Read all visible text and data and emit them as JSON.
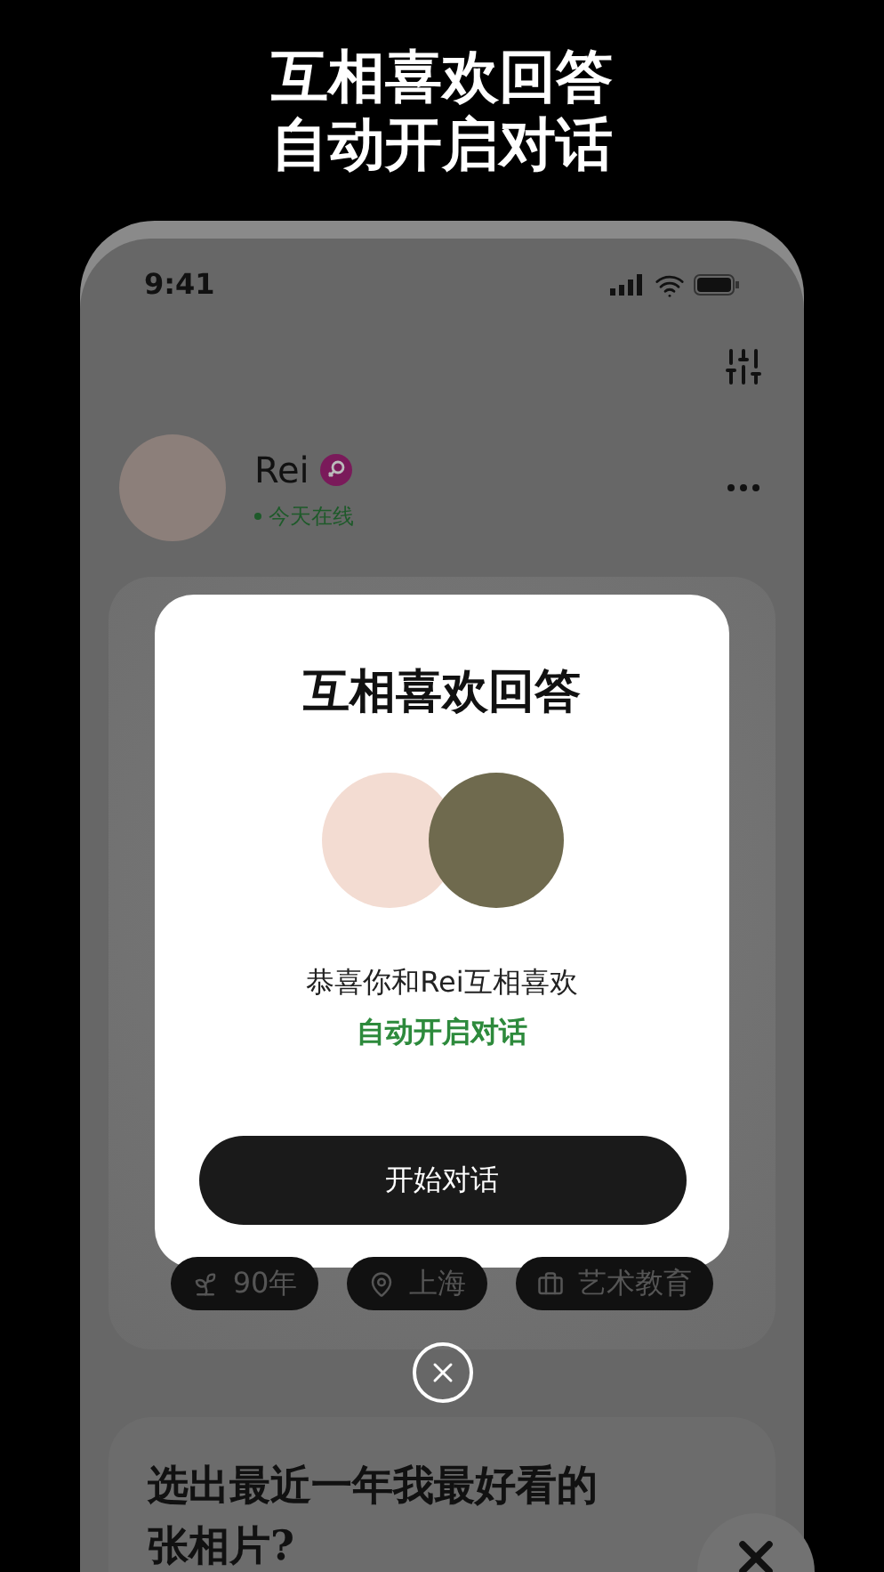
{
  "headline": [
    "互相喜欢回答",
    "自动开启对话"
  ],
  "status_bar": {
    "time": "9:41"
  },
  "profile": {
    "name": "Rei",
    "online": true,
    "status": "今天在线"
  },
  "modal": {
    "title": "互相喜欢回答",
    "message": "恭喜你和Rei互相喜欢",
    "highlight": "自动开启对话",
    "button": "开始对话"
  },
  "tags": [
    {
      "kind": "age",
      "label": "90年"
    },
    {
      "kind": "location",
      "label": "上海"
    },
    {
      "kind": "job",
      "label": "艺术教育"
    }
  ],
  "question": {
    "lines": [
      "选出最近一年我最好看的",
      "张相片?"
    ]
  }
}
